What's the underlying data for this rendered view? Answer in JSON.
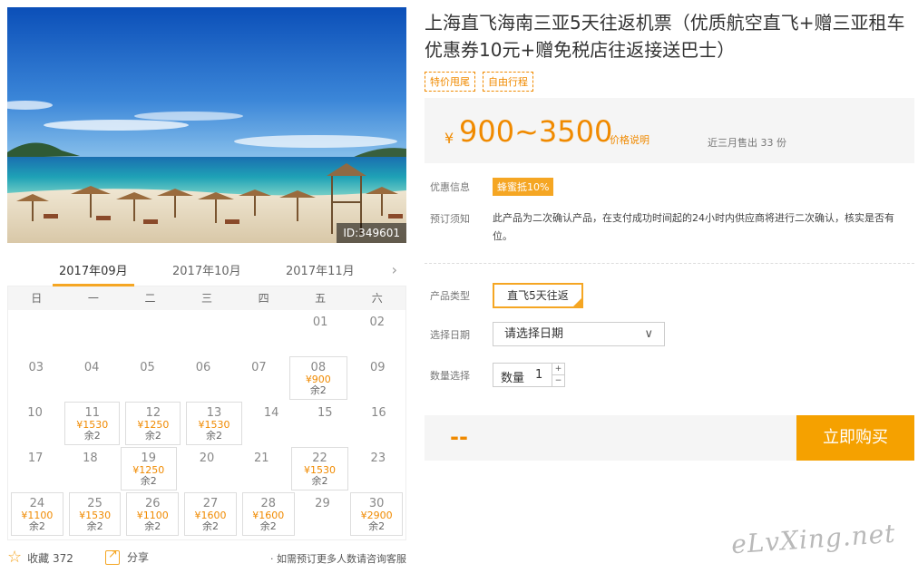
{
  "photo": {
    "id_label": "ID:349601"
  },
  "calendar": {
    "months": [
      "2017年09月",
      "2017年10月",
      "2017年11月"
    ],
    "weekdays": [
      "日",
      "一",
      "二",
      "三",
      "四",
      "五",
      "六"
    ],
    "weeks": [
      [
        null,
        null,
        null,
        null,
        null,
        {
          "d": "01"
        },
        {
          "d": "02"
        }
      ],
      [
        {
          "d": "03"
        },
        {
          "d": "04"
        },
        {
          "d": "05"
        },
        {
          "d": "06"
        },
        {
          "d": "07"
        },
        {
          "d": "08",
          "p": "¥900",
          "s": "余2"
        },
        {
          "d": "09"
        }
      ],
      [
        {
          "d": "10"
        },
        {
          "d": "11",
          "p": "¥1530",
          "s": "余2"
        },
        {
          "d": "12",
          "p": "¥1250",
          "s": "余2"
        },
        {
          "d": "13",
          "p": "¥1530",
          "s": "余2"
        },
        {
          "d": "14"
        },
        {
          "d": "15"
        },
        {
          "d": "16"
        }
      ],
      [
        {
          "d": "17"
        },
        {
          "d": "18"
        },
        {
          "d": "19",
          "p": "¥1250",
          "s": "余2"
        },
        {
          "d": "20"
        },
        {
          "d": "21"
        },
        {
          "d": "22",
          "p": "¥1530",
          "s": "余2"
        },
        {
          "d": "23"
        }
      ],
      [
        {
          "d": "24",
          "p": "¥1100",
          "s": "余2"
        },
        {
          "d": "25",
          "p": "¥1530",
          "s": "余2"
        },
        {
          "d": "26",
          "p": "¥1100",
          "s": "余2"
        },
        {
          "d": "27",
          "p": "¥1600",
          "s": "余2"
        },
        {
          "d": "28",
          "p": "¥1600",
          "s": "余2"
        },
        {
          "d": "29"
        },
        {
          "d": "30",
          "p": "¥2900",
          "s": "余2"
        }
      ]
    ]
  },
  "bottom": {
    "fav_label": "收藏 372",
    "share_label": "分享",
    "consult": "· 如需预订更多人数请咨询客服"
  },
  "product": {
    "title": "上海直飞海南三亚5天往返机票（优质航空直飞+赠三亚租车优惠券10元+赠免税店往返接送巴士）",
    "tags": [
      "特价甩尾",
      "自由行程"
    ],
    "currency": "¥",
    "price_range": "900~3500",
    "price_note": "价格说明",
    "sold": "近三月售出 33 份",
    "promo_label": "优惠信息",
    "promo_badge": "蜂蜜抵10%",
    "notice_label": "预订须知",
    "notice": "此产品为二次确认产品，在支付成功时间起的24小时内供应商将进行二次确认，核实是否有位。",
    "type_label": "产品类型",
    "type_value": "直飞5天往返",
    "date_label": "选择日期",
    "date_placeholder": "请选择日期",
    "qty_label": "数量选择",
    "qty_field_label": "数量",
    "qty_value": "1",
    "total": "--",
    "buy_label": "立即购买"
  },
  "watermark": "eLvXing.net",
  "colors": {
    "accent": "#f5a623",
    "price": "#f08a00"
  }
}
